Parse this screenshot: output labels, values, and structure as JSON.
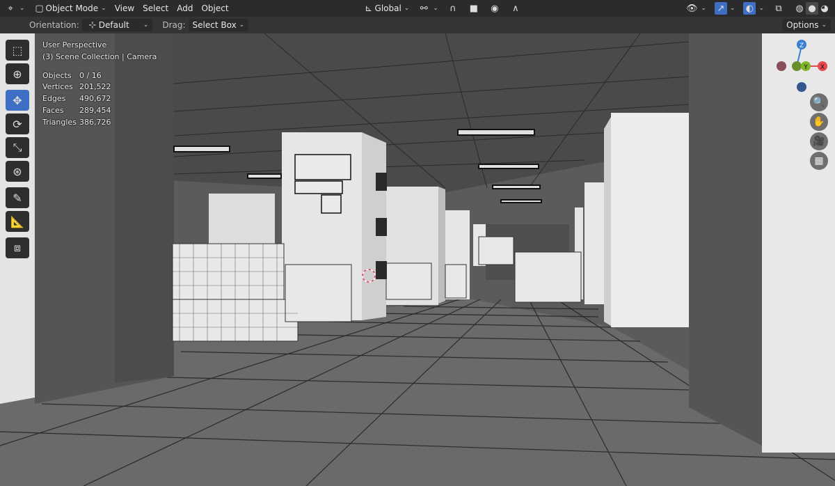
{
  "header": {
    "mode": "Object Mode",
    "menus": [
      "View",
      "Select",
      "Add",
      "Object"
    ],
    "transform_orientation": "Global"
  },
  "tool_options": {
    "orientation_label": "Orientation:",
    "orientation_value": "Default",
    "drag_label": "Drag:",
    "drag_value": "Select Box",
    "options_label": "Options"
  },
  "overlay": {
    "view_name": "User Perspective",
    "collection": "(3) Scene Collection | Camera",
    "stats": [
      {
        "label": "Objects",
        "value": "0 / 16"
      },
      {
        "label": "Vertices",
        "value": "201,522"
      },
      {
        "label": "Edges",
        "value": "490,672"
      },
      {
        "label": "Faces",
        "value": "289,454"
      },
      {
        "label": "Triangles",
        "value": "386,726"
      }
    ]
  },
  "gizmo": {
    "z_label": "Z",
    "y_label": "Y",
    "x_label": "X",
    "colors": {
      "x": "#e8474f",
      "y": "#7fb52b",
      "z": "#3a7fd6"
    }
  },
  "icons": {
    "toolbar": [
      "select-box-icon",
      "cursor-icon",
      "move-icon",
      "rotate-icon",
      "scale-icon",
      "transform-icon",
      "annotate-icon",
      "measure-icon",
      "add-cube-icon"
    ],
    "nav": [
      "zoom-icon",
      "pan-hand-icon",
      "camera-view-icon",
      "grid-ortho-icon"
    ]
  },
  "accent_color": "#3e6fc4"
}
